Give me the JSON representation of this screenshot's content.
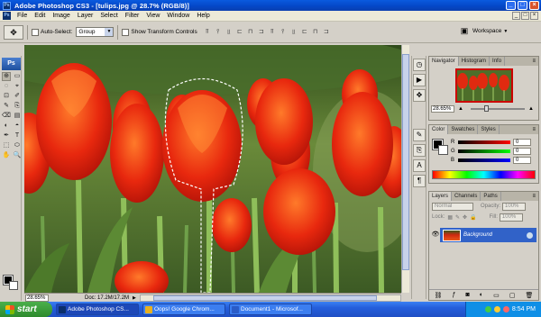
{
  "window": {
    "app_icon": "Ps",
    "title": "Adobe Photoshop CS3 - [tulips.jpg @ 28.7% (RGB/8)]",
    "controls": [
      "_",
      "□",
      "×"
    ]
  },
  "menubar": {
    "items": [
      "File",
      "Edit",
      "Image",
      "Layer",
      "Select",
      "Filter",
      "View",
      "Window",
      "Help"
    ],
    "doc_controls": [
      "_",
      "□",
      "×"
    ]
  },
  "options": {
    "tool_icon": "move-icon",
    "auto_select_label": "Auto-Select:",
    "auto_select_value": "Group",
    "show_transform_label": "Show Transform Controls",
    "workspace_label": "Workspace"
  },
  "toolbox": {
    "logo": "Ps",
    "tools": [
      "⊕",
      "▭",
      "◌",
      "⌖",
      "⊡",
      "✐",
      "✎",
      "⎘",
      "⌫",
      "▤",
      "◐",
      "◓",
      "✒",
      "T",
      "⬚",
      "⬭",
      "✋",
      "🔍"
    ]
  },
  "document": {
    "zoom": "28.65%",
    "info": "Doc: 17.2M/17.2M"
  },
  "navigator": {
    "tabs": [
      "Navigator",
      "Histogram",
      "Info"
    ],
    "zoom": "28.65%"
  },
  "color": {
    "tabs": [
      "Color",
      "Swatches",
      "Styles"
    ],
    "channels": [
      {
        "label": "R",
        "value": "0",
        "gradient": "linear-gradient(90deg,#000,#f00)"
      },
      {
        "label": "G",
        "value": "0",
        "gradient": "linear-gradient(90deg,#000,#0f0)"
      },
      {
        "label": "B",
        "value": "0",
        "gradient": "linear-gradient(90deg,#000,#00f)"
      }
    ]
  },
  "layers": {
    "tabs": [
      "Layers",
      "Channels",
      "Paths"
    ],
    "blend_mode": "Normal",
    "opacity_label": "Opacity:",
    "opacity_value": "100%",
    "lock_label": "Lock:",
    "fill_label": "Fill:",
    "fill_value": "100%",
    "items": [
      {
        "name": "Background"
      }
    ]
  },
  "taskbar": {
    "start_label": "start",
    "tasks": [
      {
        "label": "Adobe Photoshop CS...",
        "color": "#0b2f6b"
      },
      {
        "label": "Oops! Google Chrom...",
        "color": "#e8b020"
      },
      {
        "label": "Document1 - Microsof...",
        "color": "#2a5cc8"
      }
    ],
    "clock": "8:54 PM"
  }
}
